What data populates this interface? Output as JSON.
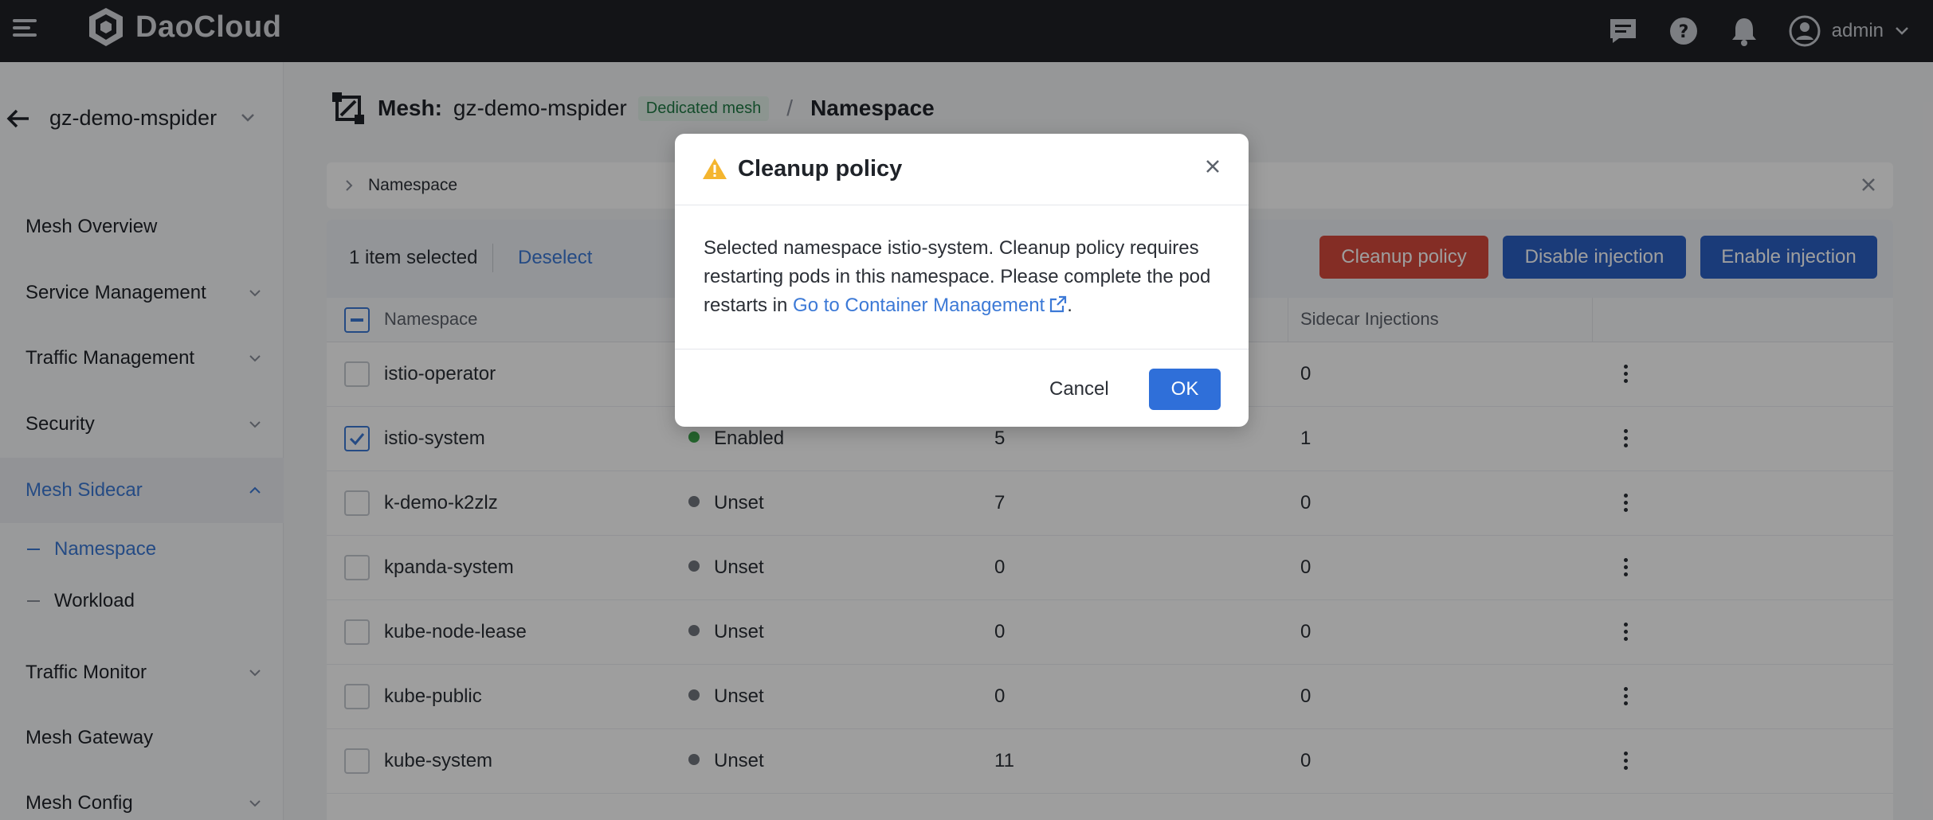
{
  "topbar": {
    "logo_text": "DaoCloud",
    "user_name": "admin"
  },
  "sidebar": {
    "mesh_name": "gz-demo-mspider",
    "items": [
      {
        "label": "Mesh Overview"
      },
      {
        "label": "Service Management"
      },
      {
        "label": "Traffic Management"
      },
      {
        "label": "Security"
      },
      {
        "label": "Mesh Sidecar"
      },
      {
        "label": "Traffic Monitor"
      },
      {
        "label": "Mesh Gateway"
      },
      {
        "label": "Mesh Config"
      }
    ],
    "sub_items": [
      {
        "label": "Namespace"
      },
      {
        "label": "Workload"
      }
    ]
  },
  "breadcrumb": {
    "mesh_label": "Mesh:",
    "mesh_name": "gz-demo-mspider",
    "badge": "Dedicated mesh",
    "separator": "/",
    "page": "Namespace"
  },
  "filter": {
    "label": "Namespace"
  },
  "selection": {
    "count_text": "1 item selected",
    "deselect": "Deselect",
    "cleanup_label": "Cleanup policy",
    "disable_label": "Disable injection",
    "enable_label": "Enable injection"
  },
  "table": {
    "col_namespace": "Namespace",
    "col_sidecar": "Sidecar Injections",
    "rows": [
      {
        "name": "istio-operator",
        "status": "",
        "status_color": "",
        "pods": "",
        "sidecar": "0",
        "checked": false
      },
      {
        "name": "istio-system",
        "status": "Enabled",
        "status_color": "#3ca34b",
        "pods": "5",
        "sidecar": "1",
        "checked": true
      },
      {
        "name": "k-demo-k2zlz",
        "status": "Unset",
        "status_color": "#72767e",
        "pods": "7",
        "sidecar": "0",
        "checked": false
      },
      {
        "name": "kpanda-system",
        "status": "Unset",
        "status_color": "#72767e",
        "pods": "0",
        "sidecar": "0",
        "checked": false
      },
      {
        "name": "kube-node-lease",
        "status": "Unset",
        "status_color": "#72767e",
        "pods": "0",
        "sidecar": "0",
        "checked": false
      },
      {
        "name": "kube-public",
        "status": "Unset",
        "status_color": "#72767e",
        "pods": "0",
        "sidecar": "0",
        "checked": false
      },
      {
        "name": "kube-system",
        "status": "Unset",
        "status_color": "#72767e",
        "pods": "11",
        "sidecar": "0",
        "checked": false
      }
    ]
  },
  "dialog": {
    "title": "Cleanup policy",
    "body_prefix": "Selected namespace istio-system. Cleanup policy requires restarting pods in this namespace. Please complete the pod restarts in ",
    "link_text": "Go to Container Management",
    "body_suffix": ".",
    "cancel_label": "Cancel",
    "ok_label": "OK"
  },
  "colors": {
    "accent": "#3c79d6",
    "danger": "#d64a3d",
    "primary_button": "#2a5fc4",
    "topbar": "#1f2126",
    "enabled": "#3ca34b",
    "unset": "#72767e",
    "warning": "#f4b52e"
  }
}
